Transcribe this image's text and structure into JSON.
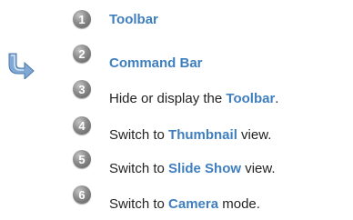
{
  "colors": {
    "highlight": "#3f7fbf",
    "text": "#222222",
    "badge": "#7a7a7a",
    "pointer_icon": "#7fa8d4"
  },
  "pointer_icon": "curved-arrow-icon",
  "items": [
    {
      "number": "1",
      "label": "Toolbar"
    },
    {
      "number": "2",
      "label": "Command Bar"
    },
    {
      "number": "3",
      "pre": "Hide or display the ",
      "hl": "Toolbar",
      "post": "."
    },
    {
      "number": "4",
      "pre": "Switch to ",
      "hl": "Thumbnail",
      "post": " view."
    },
    {
      "number": "5",
      "pre": "Switch to ",
      "hl": "Slide Show",
      "post": " view."
    },
    {
      "number": "6",
      "pre": "Switch to ",
      "hl": "Camera",
      "post": " mode."
    }
  ]
}
